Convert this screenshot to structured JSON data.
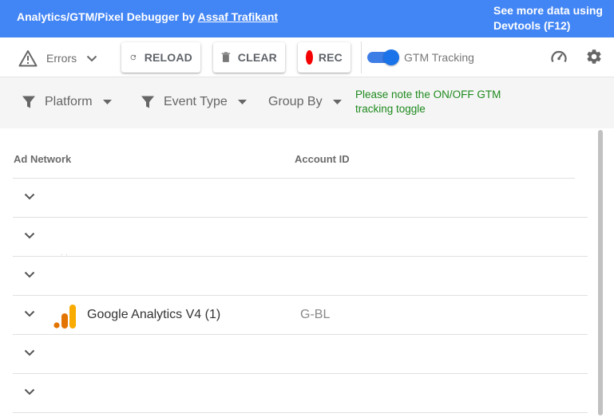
{
  "header": {
    "title_prefix": "Analytics/GTM/Pixel Debugger by ",
    "author": "Assaf Trafikant",
    "devtools_note": "See more data using Devtools (F12)"
  },
  "toolbar": {
    "errors_label": "Errors",
    "reload_label": "RELOAD",
    "clear_label": "CLEAR",
    "rec_label": "REC",
    "gtm_toggle_label": "GTM Tracking",
    "gtm_toggle_on": true,
    "rec_color": "#f50000",
    "accent_color": "#4285f4"
  },
  "filters": {
    "platform": "Platform",
    "event_type": "Event Type",
    "group_by": "Group By",
    "note": "Please note the ON/OFF GTM tracking toggle"
  },
  "table": {
    "columns": [
      "Ad Network",
      "Account ID"
    ],
    "rows": [
      {
        "name": "",
        "account": ""
      },
      {
        "name": "",
        "account": "",
        "partial": ". ."
      },
      {
        "name": "",
        "account": ""
      },
      {
        "name": "Google Analytics V4 (1)",
        "account": "G-BL",
        "icon": "google-analytics-icon"
      },
      {
        "name": "",
        "account": ""
      },
      {
        "name": "",
        "account": ""
      }
    ]
  }
}
